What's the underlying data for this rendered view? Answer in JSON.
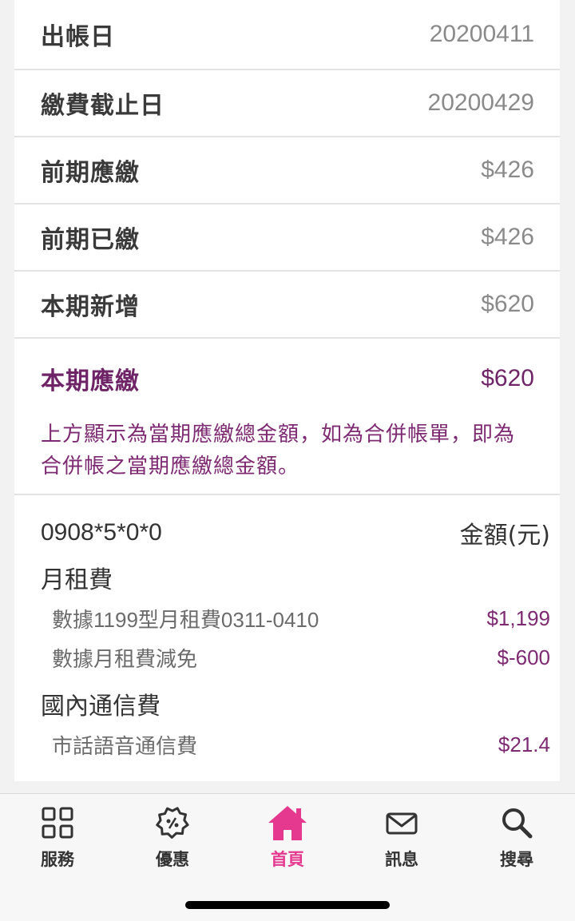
{
  "summary": [
    {
      "label": "出帳日",
      "value": "20200411"
    },
    {
      "label": "繳費截止日",
      "value": "20200429"
    },
    {
      "label": "前期應繳",
      "value": "$426"
    },
    {
      "label": "前期已繳",
      "value": "$426"
    },
    {
      "label": "本期新增",
      "value": "$620"
    }
  ],
  "total": {
    "label": "本期應繳",
    "value": "$620",
    "note": "上方顯示為當期應繳總金額，如為合併帳單，即為合併帳之當期應繳總金額。"
  },
  "detail": {
    "number": "0908*5*0*0",
    "amount_header": "金額(元)",
    "categories": [
      {
        "title": "月租費",
        "items": [
          {
            "name": "數據1199型月租費0311-0410",
            "amount": "$1,199"
          },
          {
            "name": "數據月租費減免",
            "amount": "$-600"
          }
        ]
      },
      {
        "title": "國內通信費",
        "items": [
          {
            "name": "市話語音通信費",
            "amount": "$21.4"
          }
        ]
      }
    ]
  },
  "tabbar": {
    "active_color": "#e5388f",
    "tabs": [
      {
        "label": "服務",
        "icon": "grid-icon"
      },
      {
        "label": "優惠",
        "icon": "coupon-tag-icon"
      },
      {
        "label": "首頁",
        "icon": "home-icon",
        "active": true
      },
      {
        "label": "訊息",
        "icon": "mail-icon"
      },
      {
        "label": "搜尋",
        "icon": "search-icon"
      }
    ]
  }
}
